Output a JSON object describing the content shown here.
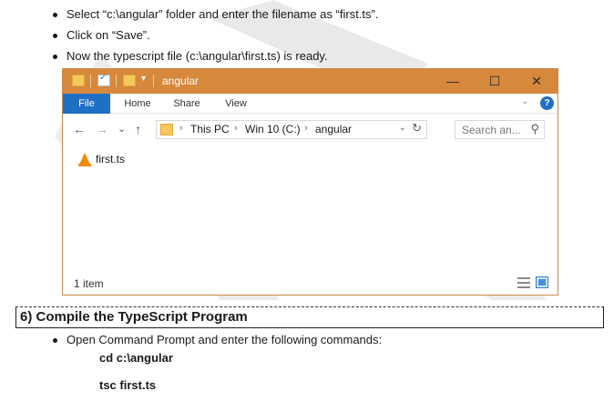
{
  "bullets": [
    "Select “c:\\angular” folder and enter the filename as “first.ts”.",
    "Click on “Save”.",
    "Now the typescript file (c:\\angular\\first.ts) is ready."
  ],
  "explorer": {
    "title": "angular",
    "window_buttons": {
      "minimize": "—",
      "maximize": "☐",
      "close": "✕"
    },
    "ribbon_tabs": [
      "File",
      "Home",
      "Share",
      "View"
    ],
    "help": "?",
    "nav": {
      "back": "←",
      "forward": "→",
      "recent": "⌄",
      "up": "↑"
    },
    "breadcrumb": [
      "This PC",
      "Win 10 (C:)",
      "angular"
    ],
    "search_placeholder": "Search an...",
    "files": [
      {
        "name": "first.ts",
        "icon": "vlc-cone-icon"
      }
    ],
    "status": "1 item"
  },
  "section": {
    "title": "6) Compile the TypeScript Program"
  },
  "instruction": "Open Command Prompt and enter the following commands:",
  "commands": [
    "cd  c:\\angular",
    "tsc  first.ts"
  ],
  "colors": {
    "titlebar": "#d6883b",
    "file_tab": "#1f6fc5",
    "watermark": "#e8e8e8"
  }
}
